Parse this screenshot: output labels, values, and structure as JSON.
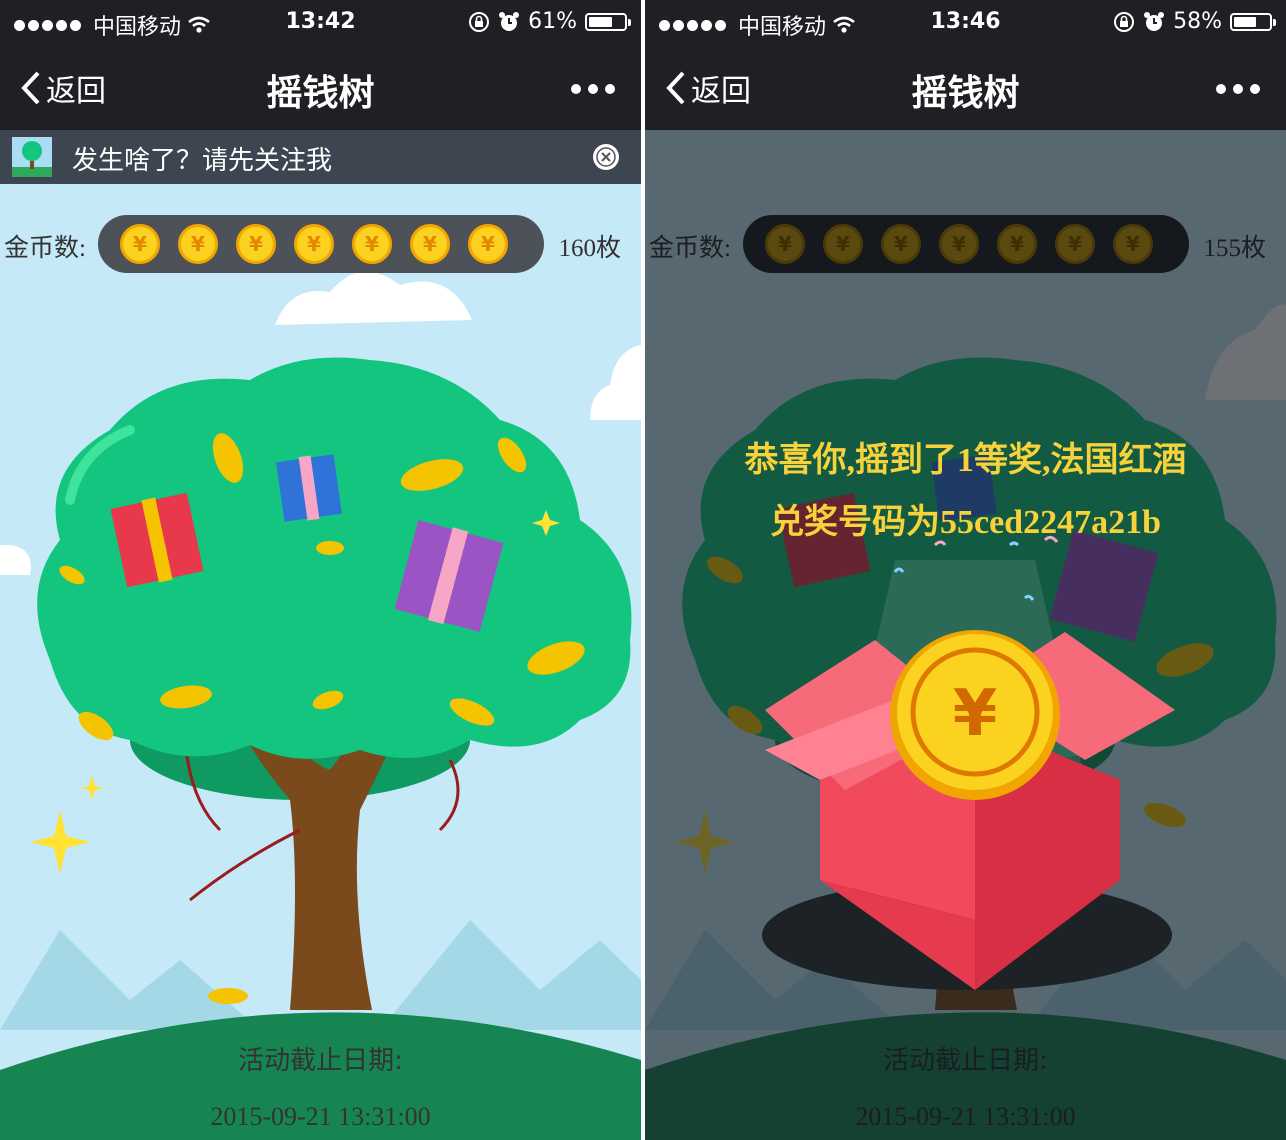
{
  "left": {
    "status": {
      "carrier": "中国移动",
      "time": "13:42",
      "battery": "61%",
      "battery_level": 0.61
    },
    "nav": {
      "back_label": "返回",
      "title": "摇钱树"
    },
    "follow_banner": {
      "text": "发生啥了？请先关注我"
    },
    "coins": {
      "label": "金币数:",
      "count": "160枚",
      "icon_symbol": "¥",
      "icon_count": 7
    },
    "deadline": {
      "label": "活动截止日期:",
      "date": "2015-09-21 13:31:00"
    }
  },
  "right": {
    "status": {
      "carrier": "中国移动",
      "time": "13:46",
      "battery": "58%",
      "battery_level": 0.58
    },
    "nav": {
      "back_label": "返回",
      "title": "摇钱树"
    },
    "coins": {
      "label": "金币数:",
      "count": "155枚",
      "icon_symbol": "¥",
      "icon_count": 7
    },
    "prize": {
      "line1": "恭喜你,摇到了1等奖,法国红酒",
      "line2": "兑奖号码为55ced2247a21b",
      "coin_symbol": "¥"
    },
    "deadline": {
      "label": "活动截止日期:",
      "date": "2015-09-21 13:31:00"
    }
  },
  "colors": {
    "nav_bg": "#1e2023",
    "sky": "#c6e9f8",
    "tree_green": "#14c47e",
    "coin_gold": "#fbd220",
    "prize_text": "#f8d23a",
    "box_red": "#f2455a"
  }
}
